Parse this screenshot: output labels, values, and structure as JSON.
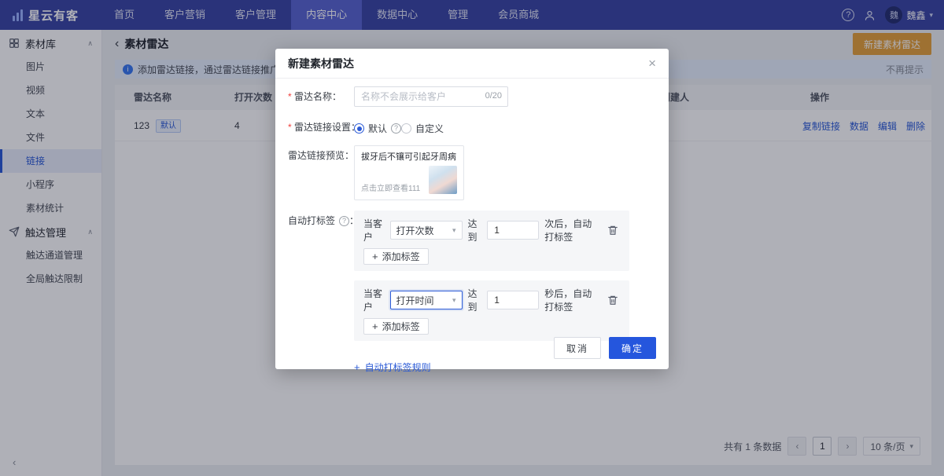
{
  "colors": {
    "brand_navy": "#3c47a6",
    "primary_blue": "#2b5bd7",
    "accent_orange": "#e6a23c",
    "danger_red": "#f0413e",
    "banner_bg": "#e7f0fe"
  },
  "icons": {
    "question": "?",
    "chevron_down": "▾",
    "chevron_up": "∧",
    "back": "‹",
    "collapse": "‹",
    "close": "×",
    "plus": "+",
    "info": "i",
    "prev": "‹",
    "next": "›"
  },
  "navbar": {
    "logo_text": "星云有客",
    "items": [
      {
        "label": "首页"
      },
      {
        "label": "客户营销"
      },
      {
        "label": "客户管理"
      },
      {
        "label": "内容中心"
      },
      {
        "label": "数据中心"
      },
      {
        "label": "管理"
      },
      {
        "label": "会员商城"
      }
    ],
    "active_item": "内容中心",
    "user_name": "魏鑫",
    "user_initial": "魏"
  },
  "sidebar": {
    "group1_label": "素材库",
    "group1_items": [
      {
        "label": "图片"
      },
      {
        "label": "视频"
      },
      {
        "label": "文本"
      },
      {
        "label": "文件"
      },
      {
        "label": "链接"
      },
      {
        "label": "小程序"
      },
      {
        "label": "素材统计"
      }
    ],
    "active_item": "链接",
    "group2_label": "触达管理",
    "group2_items": [
      {
        "label": "触达通道管理"
      },
      {
        "label": "全局触达限制"
      }
    ]
  },
  "page": {
    "back_title": "素材雷达",
    "create_button": "新建素材雷达",
    "banner_text": "添加雷达链接，通过雷达链接推广可统计发送内容的点",
    "banner_dismiss": "不再提示",
    "table": {
      "col_name": "雷达名称",
      "col_opens": "打开次数",
      "col_creator": "创建人",
      "col_actions": "操作",
      "row_name": "123",
      "row_tag": "默认",
      "row_opens": "4",
      "actions": [
        {
          "label": "复制链接"
        },
        {
          "label": "数据"
        },
        {
          "label": "编辑"
        },
        {
          "label": "删除"
        }
      ]
    },
    "pagination": {
      "total": "共有 1 条数据",
      "page": "1",
      "size": "10 条/页"
    }
  },
  "modal": {
    "title": "新建素材雷达",
    "name_label": "雷达名称：",
    "name_placeholder": "名称不会展示给客户",
    "name_counter": "0/20",
    "link_label": "雷达链接设置：",
    "radio_default": "默认",
    "radio_custom": "自定义",
    "link_selected": "默认",
    "preview_label": "雷达链接预览：",
    "preview_title": "拔牙后不镶可引起牙周病",
    "preview_desc": "点击立即查看111",
    "autotag_label": "自动打标签",
    "autotag_colon": "：",
    "rules": [
      {
        "prefix": "当客户",
        "metric": "打开次数",
        "reach": "达到",
        "value": "1",
        "suffix": "次后，自动打标签",
        "add_label": "添加标签"
      },
      {
        "prefix": "当客户",
        "metric": "打开时间",
        "reach": "达到",
        "value": "1",
        "suffix": "秒后，自动打标签",
        "add_label": "添加标签"
      }
    ],
    "add_rule_label": "自动打标签规则",
    "cancel": "取消",
    "confirm": "确定"
  }
}
